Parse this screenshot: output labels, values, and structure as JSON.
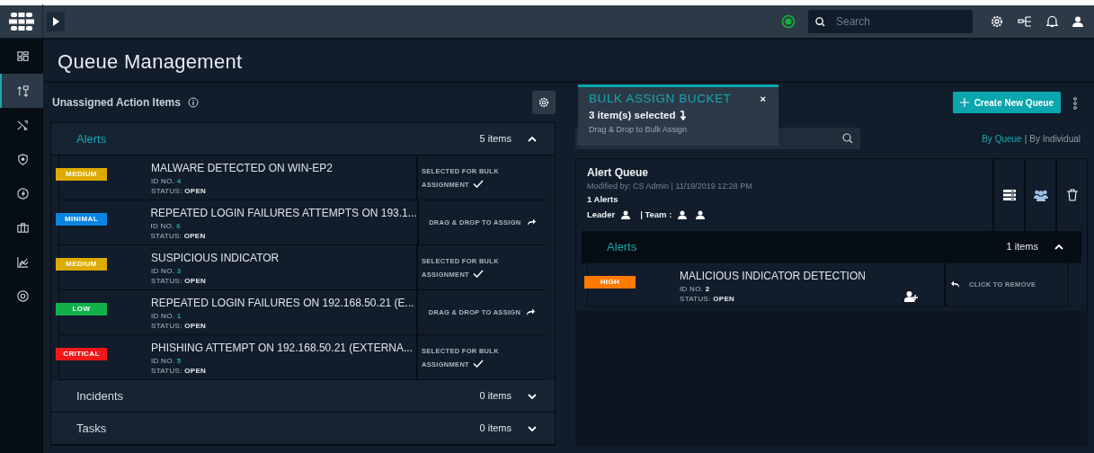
{
  "topbar": {
    "search": {
      "placeholder": "Search"
    }
  },
  "sidebar": {
    "items": [
      {
        "kind": "grid",
        "selected": false
      },
      {
        "kind": "swap",
        "selected": true
      },
      {
        "kind": "shuffle",
        "selected": false
      },
      {
        "kind": "shield",
        "selected": false
      },
      {
        "kind": "bolt",
        "selected": false
      },
      {
        "kind": "briefcase",
        "selected": false
      },
      {
        "kind": "chart",
        "selected": false
      },
      {
        "kind": "lifebuoy",
        "selected": false
      }
    ]
  },
  "page_title": "Queue Management",
  "unassigned": {
    "title": "Unassigned Action Items",
    "groups": [
      {
        "label": "Alerts",
        "count": "5 items",
        "expanded": true,
        "items": [
          {
            "severity": "MEDIUM",
            "color": "#ddaa00",
            "title": "MALWARE DETECTED ON WIN-EP2",
            "id_label": "ID NO.",
            "id": "4",
            "status_label": "STATUS:",
            "status": "OPEN",
            "action": {
              "kind": "selected",
              "label": "SELECTED FOR BULK ASSIGNMENT"
            }
          },
          {
            "severity": "MINIMAL",
            "color": "#0a84e0",
            "title": "REPEATED LOGIN FAILURES ATTEMPTS ON 193.1...",
            "id_label": "ID NO.",
            "id": "6",
            "status_label": "STATUS:",
            "status": "OPEN",
            "action": {
              "kind": "drag",
              "label": "DRAG & DROP TO ASSIGN"
            }
          },
          {
            "severity": "MEDIUM",
            "color": "#ddaa00",
            "title": "SUSPICIOUS INDICATOR",
            "id_label": "ID NO.",
            "id": "3",
            "status_label": "STATUS:",
            "status": "OPEN",
            "action": {
              "kind": "selected",
              "label": "SELECTED FOR BULK ASSIGNMENT"
            }
          },
          {
            "severity": "LOW",
            "color": "#12b04a",
            "title": "REPEATED LOGIN FAILURES ON 192.168.50.21 (E...",
            "id_label": "ID NO.",
            "id": "1",
            "status_label": "STATUS:",
            "status": "OPEN",
            "action": {
              "kind": "drag",
              "label": "DRAG & DROP TO ASSIGN"
            }
          },
          {
            "severity": "CRITICAL",
            "color": "#f01818",
            "title": "PHISHING ATTEMPT ON 192.168.50.21 (EXTERNA...",
            "id_label": "ID NO.",
            "id": "5",
            "status_label": "STATUS:",
            "status": "OPEN",
            "action": {
              "kind": "selected",
              "label": "SELECTED FOR BULK ASSIGNMENT"
            }
          }
        ]
      },
      {
        "label": "Incidents",
        "count": "0 items",
        "expanded": false
      },
      {
        "label": "Tasks",
        "count": "0 items",
        "expanded": false
      }
    ]
  },
  "bulk_bucket": {
    "title": "BULK ASSIGN BUCKET",
    "close": "×",
    "selected_count": "3 item(s) selected",
    "hint": "Drag & Drop to Bulk Assign"
  },
  "queues_panel": {
    "create_button": "Create New Queue",
    "view_toggle_divider": "|",
    "view_toggle": [
      {
        "label": "By Queue",
        "selected": true
      },
      {
        "label": "By Individual",
        "selected": false
      }
    ],
    "queues": [
      {
        "name": "Alert Queue",
        "modified": "Modified by: CS Admin | 11/19/2019 12:28 PM",
        "count": "1 Alerts",
        "leader_label": "Leader",
        "team_label": "| Team :",
        "groups": [
          {
            "label": "Alerts",
            "count": "1 items",
            "expanded": true,
            "items": [
              {
                "severity": "HIGH",
                "color": "#ff7a00",
                "title": "MALICIOUS INDICATOR DETECTION",
                "id_label": "ID NO.",
                "id": "2",
                "status_label": "STATUS:",
                "status": "OPEN",
                "action": {
                  "kind": "remove",
                  "label": "CLICK TO REMOVE"
                }
              }
            ]
          }
        ]
      }
    ]
  }
}
